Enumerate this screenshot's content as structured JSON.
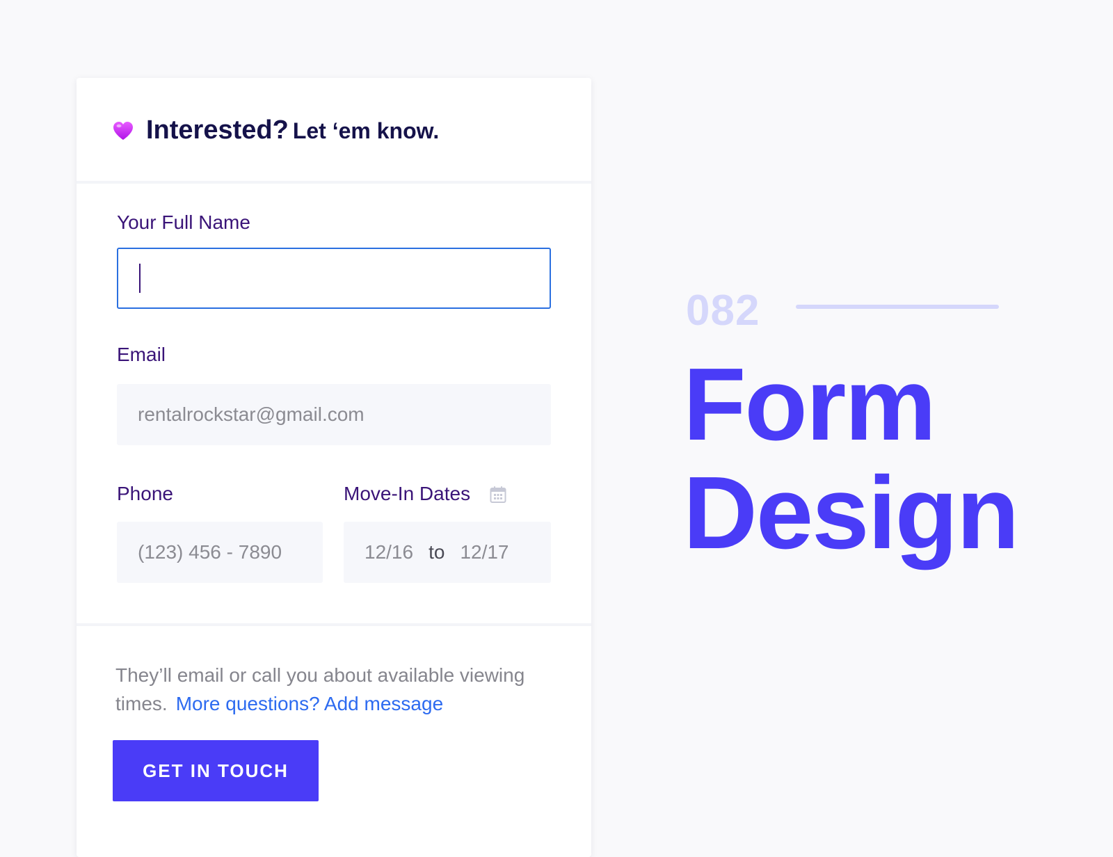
{
  "form": {
    "header": {
      "icon": "heart-icon",
      "title_main": "Interested?",
      "title_sub": "Let ‘em know."
    },
    "full_name": {
      "label": "Your Full Name",
      "value": "",
      "state": "focused"
    },
    "email": {
      "label": "Email",
      "placeholder": "rentalrockstar@gmail.com"
    },
    "phone": {
      "label": "Phone",
      "placeholder": "(123) 456 - 7890"
    },
    "move_in": {
      "label": "Move-In Dates",
      "icon": "calendar-icon",
      "from": "12/16",
      "separator": "to",
      "to": "12/17"
    },
    "note": {
      "text": "They’ll email or call you about available viewing times.",
      "link": "More questions? Add message"
    },
    "submit_label": "GET IN TOUCH"
  },
  "showcase": {
    "number": "082",
    "title_line1": "Form",
    "title_line2": "Design"
  },
  "colors": {
    "background": "#f9f9fb",
    "card": "#ffffff",
    "heading": "#15124a",
    "label": "#3a1478",
    "input_bg": "#f6f7fb",
    "focus_border": "#2a6fe0",
    "link": "#2d6bf0",
    "accent": "#4a3cf7",
    "accent_light": "#d5d7fb",
    "heart": "#c21ff2"
  }
}
